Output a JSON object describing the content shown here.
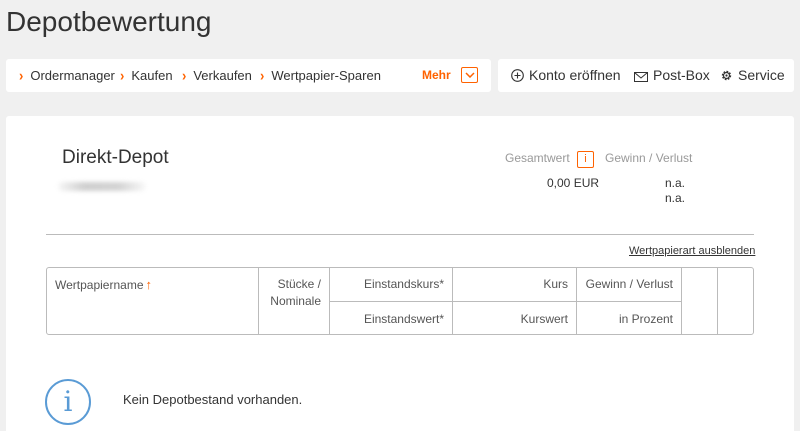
{
  "page": {
    "title": "Depotbewertung"
  },
  "nav": {
    "items": [
      {
        "label": "Ordermanager"
      },
      {
        "label": "Kaufen"
      },
      {
        "label": "Verkaufen"
      },
      {
        "label": "Wertpapier-Sparen"
      }
    ],
    "more_label": "Mehr"
  },
  "services": {
    "open_account": "Konto eröffnen",
    "post_box": "Post-Box",
    "service": "Service"
  },
  "depot": {
    "name": "Direkt-Depot",
    "total_label": "Gesamtwert",
    "profit_label": "Gewinn / Verlust",
    "total_value": "0,00 EUR",
    "profit_value": "n.a.",
    "profit_percent": "n.a.",
    "hide_type_link": "Wertpapierart ausblenden"
  },
  "table": {
    "col_name": "Wertpapiername",
    "col_pieces_line1": "Stücke /",
    "col_pieces_line2": "Nominale",
    "col_cost_price": "Einstandskurs*",
    "col_cost_value": "Einstandswert*",
    "col_price": "Kurs",
    "col_market_value": "Kurswert",
    "col_profit": "Gewinn / Verlust",
    "col_profit_pct": "in Prozent"
  },
  "empty_state": {
    "message": "Kein Depotbestand vorhanden."
  },
  "colors": {
    "accent": "#ff6200",
    "info": "#5a9bd5"
  }
}
